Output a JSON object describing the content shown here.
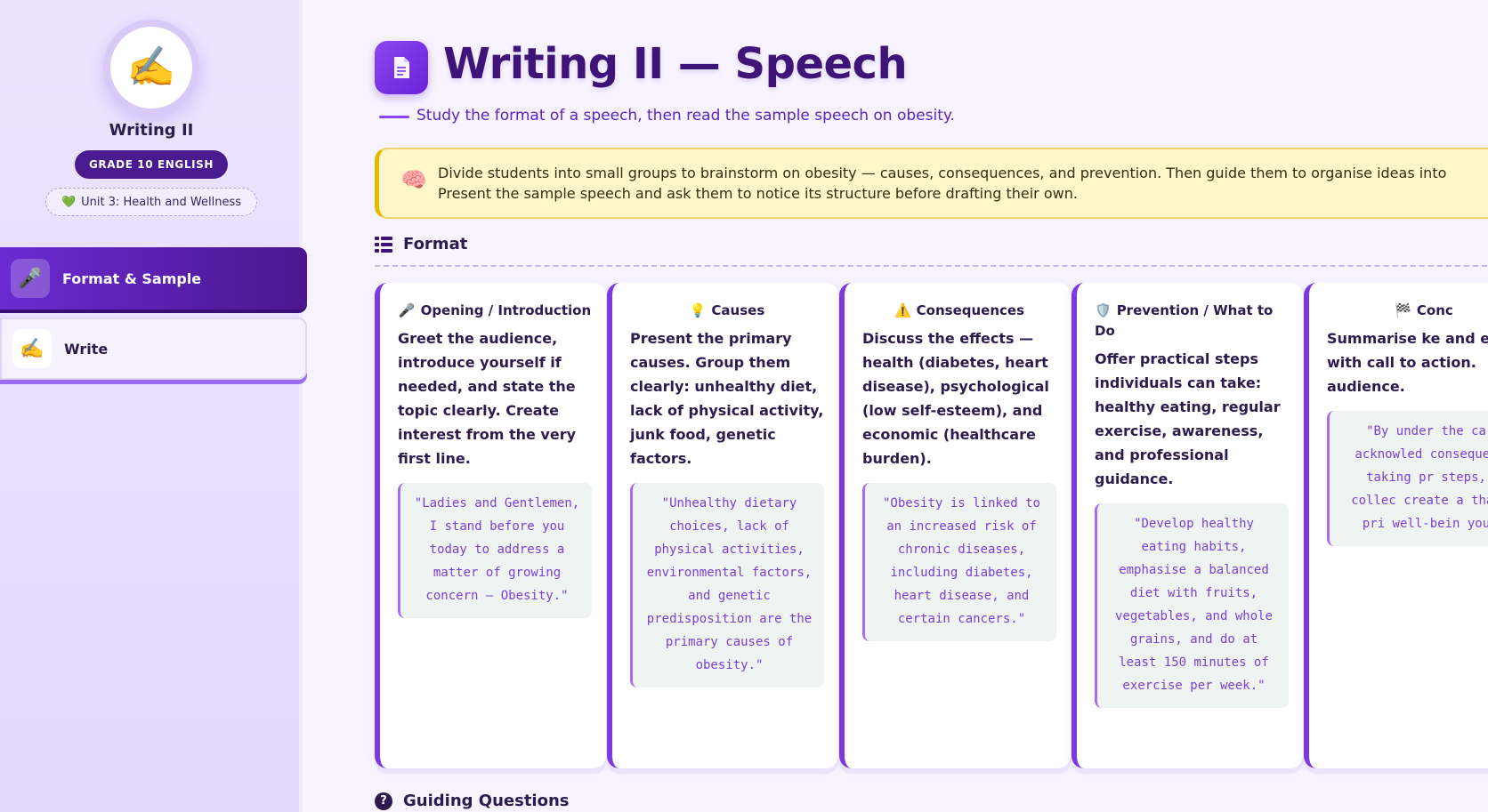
{
  "sidebar": {
    "avatar_icon": "✍️",
    "title": "Writing II",
    "grade": "GRADE 10 ENGLISH",
    "unit": "Unit 3: Health and Wellness",
    "unit_icon": "💚",
    "nav": [
      {
        "label": "Format & Sample",
        "icon": "🎤",
        "active": true
      },
      {
        "label": "Write",
        "icon": "✍️",
        "active": false
      }
    ]
  },
  "header": {
    "title": "Writing II — Speech",
    "subtitle": "Study the format of a speech, then read the sample speech on obesity."
  },
  "tip": {
    "icon": "🧠",
    "line1": "Divide students into small groups to brainstorm on obesity — causes, consequences, and prevention. Then guide them to organise ideas into",
    "line2": "Present the sample speech and ask them to notice its structure before drafting their own."
  },
  "format": {
    "heading": "Format",
    "cards": [
      {
        "icon": "🎤",
        "title": "Opening / Introduction",
        "body": "Greet the audience, introduce yourself if needed, and state the topic clearly. Create interest from the very first line.",
        "quote": "\"Ladies and Gentlemen, I stand before you today to address a matter of growing concern — Obesity.\""
      },
      {
        "icon": "💡",
        "title": "Causes",
        "body": "Present the primary causes. Group them clearly: unhealthy diet, lack of physical activity, junk food, genetic factors.",
        "quote": "\"Unhealthy dietary choices, lack of physical activities, environmental factors, and genetic predisposition are the primary causes of obesity.\""
      },
      {
        "icon": "⚠️",
        "title": "Consequences",
        "body": "Discuss the effects — health (diabetes, heart disease), psychological (low self-esteem), and economic (healthcare burden).",
        "quote": "\"Obesity is linked to an increased risk of chronic diseases, including diabetes, heart disease, and certain cancers.\""
      },
      {
        "icon": "🛡️",
        "title": "Prevention / What to Do",
        "body": "Offer practical steps individuals can take: healthy eating, regular exercise, awareness, and professional guidance.",
        "quote": "\"Develop healthy eating habits, emphasise a balanced diet with fruits, vegetables, and whole grains, and do at least 150 minutes of exercise per week.\""
      },
      {
        "icon": "🏁",
        "title": "Conc",
        "body": "Summarise ke and end with call to action. audience.",
        "quote": "\"By under the ca acknowled consequen taking pr steps, collec create a that pri well-bein you"
      }
    ]
  },
  "guiding": {
    "heading": "Guiding Questions"
  }
}
